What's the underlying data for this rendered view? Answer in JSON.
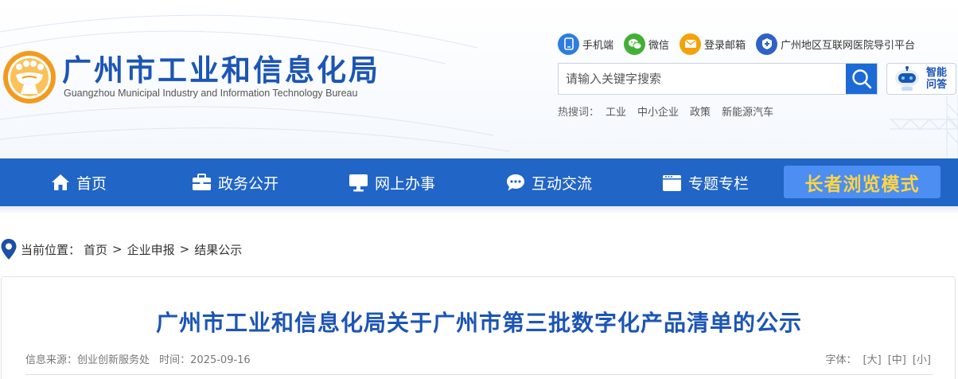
{
  "header": {
    "site_title": "广州市工业和信息化局",
    "site_subtitle": "Guangzhou Municipal Industry and Information Technology Bureau",
    "quicklinks": [
      {
        "label": "手机端",
        "icon": "mobile-icon",
        "color": "#2e7de0"
      },
      {
        "label": "微信",
        "icon": "wechat-icon",
        "color": "#41b035"
      },
      {
        "label": "登录邮箱",
        "icon": "mail-icon",
        "color": "#f4a20a"
      },
      {
        "label": "广州地区互联网医院导引平台",
        "icon": "hospital-shield-icon",
        "color": "#2e62c7"
      }
    ],
    "search": {
      "placeholder": "请输入关键字搜索"
    },
    "ai_button": {
      "line1": "智能",
      "line2": "问答"
    },
    "hotwords": {
      "label": "热搜词：",
      "items": [
        "工业",
        "中小企业",
        "政策",
        "新能源汽车"
      ]
    }
  },
  "nav": {
    "items": [
      {
        "label": "首页",
        "icon": "home-icon"
      },
      {
        "label": "政务公开",
        "icon": "briefcase-icon"
      },
      {
        "label": "网上办事",
        "icon": "monitor-icon"
      },
      {
        "label": "互动交流",
        "icon": "chat-bubble-icon"
      },
      {
        "label": "专题专栏",
        "icon": "calendar-icon"
      }
    ],
    "elder_mode": "长者浏览模式"
  },
  "breadcrumb": {
    "label": "当前位置：",
    "items": [
      "首页",
      "企业申报",
      "结果公示"
    ],
    "separator": ">"
  },
  "article": {
    "title": "广州市工业和信息化局关于广州市第三批数字化产品清单的公示",
    "source": "信息来源：创业创新服务处",
    "time": "时间：2025-09-16",
    "fontsize_label": "字体：",
    "fontsize_options": [
      "[大]",
      "[中]",
      "[小]"
    ]
  },
  "colors": {
    "brand_blue": "#1c55b5",
    "nav_blue": "#2165c6",
    "elder_bg": "#4c8ef1",
    "elder_text": "#ffd543"
  }
}
